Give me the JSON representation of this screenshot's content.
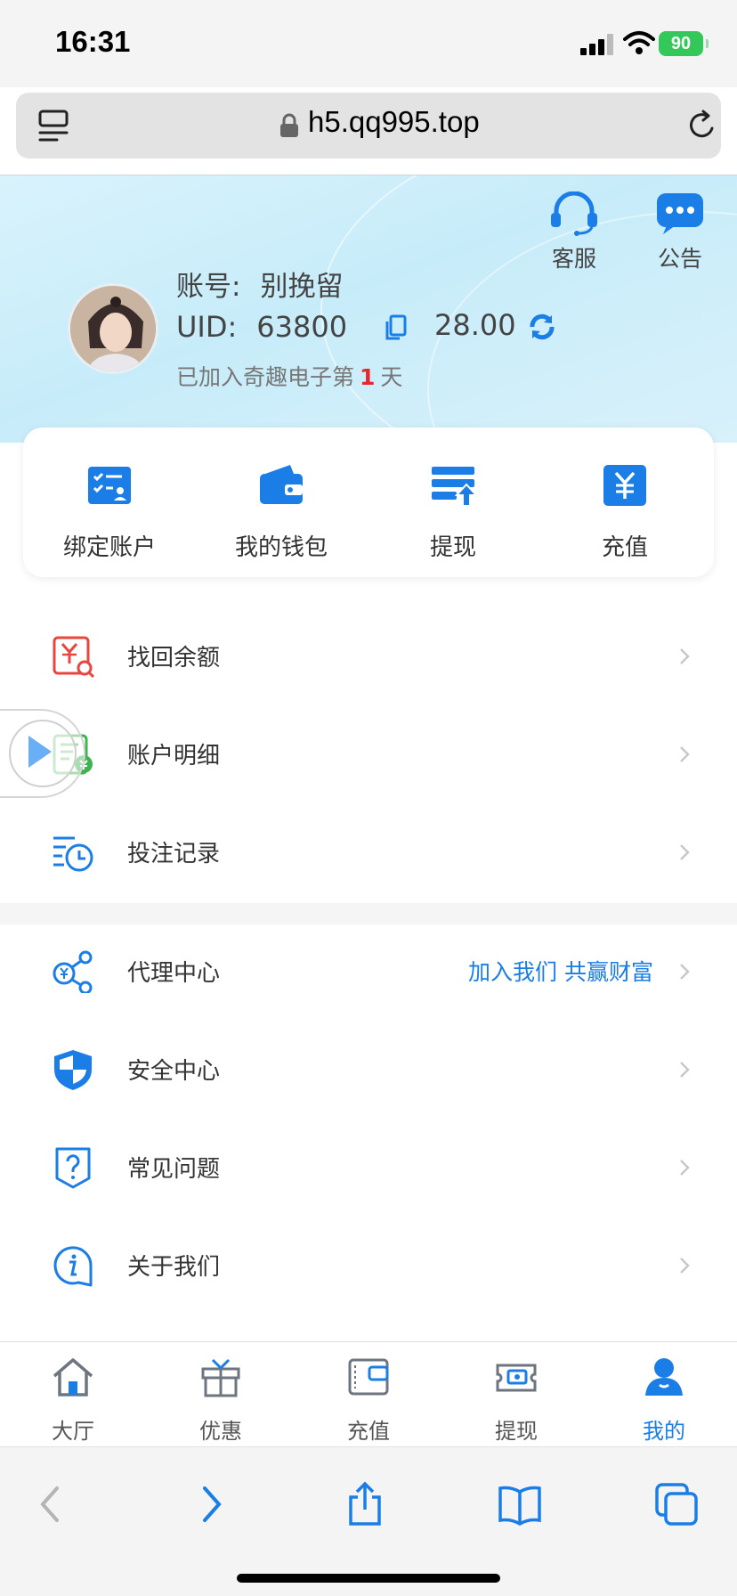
{
  "status_bar": {
    "time": "16:31",
    "battery": "90"
  },
  "browser": {
    "url": "h5.qq995.top"
  },
  "header": {
    "service_label": "客服",
    "notice_label": "公告",
    "account_label": "账号:",
    "account_name": "别挽留",
    "uid_label": "UID:",
    "uid_value": "63800",
    "balance": "28.00",
    "joined_prefix": "已加入奇趣电子第",
    "joined_days": "1",
    "joined_suffix": "天"
  },
  "quick_actions": [
    {
      "label": "绑定账户",
      "icon": "bind-account-icon"
    },
    {
      "label": "我的钱包",
      "icon": "wallet-icon"
    },
    {
      "label": "提现",
      "icon": "withdraw-icon"
    },
    {
      "label": "充值",
      "icon": "recharge-icon"
    }
  ],
  "menu": [
    {
      "label": "找回余额",
      "icon": "recover-balance-icon"
    },
    {
      "label": "账户明细",
      "icon": "account-detail-icon"
    },
    {
      "label": "投注记录",
      "icon": "bet-record-icon"
    },
    {
      "label": "代理中心",
      "icon": "agent-center-icon",
      "extra": "加入我们 共赢财富"
    },
    {
      "label": "安全中心",
      "icon": "shield-icon"
    },
    {
      "label": "常见问题",
      "icon": "faq-icon"
    },
    {
      "label": "关于我们",
      "icon": "info-icon"
    }
  ],
  "tabs": [
    {
      "label": "大厅",
      "icon": "home-icon"
    },
    {
      "label": "优惠",
      "icon": "gift-icon"
    },
    {
      "label": "充值",
      "icon": "deposit-icon"
    },
    {
      "label": "提现",
      "icon": "cash-out-icon"
    },
    {
      "label": "我的",
      "icon": "user-icon",
      "active": true
    }
  ],
  "colors": {
    "accent": "#1a7ee6",
    "header_bg": "#c9edfa",
    "highlight_red": "#e8262b"
  }
}
